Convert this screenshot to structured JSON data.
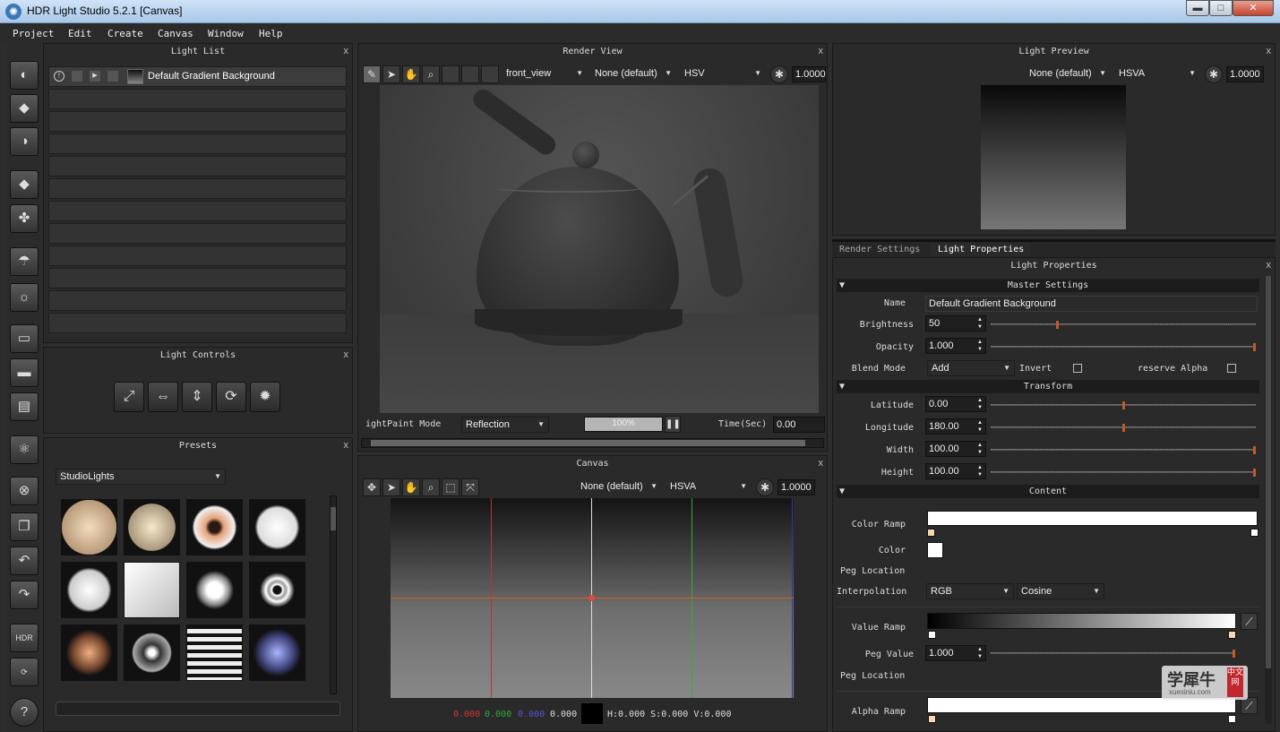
{
  "window": {
    "title": "HDR Light Studio 5.2.1 [Canvas]",
    "min": "▬",
    "max": "□",
    "close": "✕"
  },
  "menu": [
    "Project",
    "Edit",
    "Create",
    "Canvas",
    "Window",
    "Help"
  ],
  "light_list": {
    "title": "Light List",
    "close": "x",
    "item": "Default Gradient Background"
  },
  "light_controls": {
    "title": "Light Controls",
    "close": "x"
  },
  "presets": {
    "title": "Presets",
    "close": "x",
    "category": "StudioLights"
  },
  "render_view": {
    "title": "Render View",
    "close": "x",
    "camera": "front_view",
    "lut": "None (default)",
    "mode": "HSV",
    "exposure": "1.0000",
    "paint_mode_label": "ightPaint Mode",
    "paint_mode": "Reflection",
    "progress": "100%",
    "progress_value": 1.0,
    "time_label": "Time(Sec)",
    "time": "0.00"
  },
  "canvas": {
    "title": "Canvas",
    "close": "x",
    "lut": "None (default)",
    "mode": "HSVA",
    "exposure": "1.0000",
    "r": "0.000",
    "g": "0.000",
    "b": "0.000",
    "a": "0.000",
    "hsv": "H:0.000 S:0.000 V:0.000"
  },
  "light_preview": {
    "title": "Light Preview",
    "close": "x",
    "lut": "None (default)",
    "mode": "HSVA",
    "exposure": "1.0000"
  },
  "tabs": [
    "Render Settings",
    "Light Properties"
  ],
  "props": {
    "title": "Light Properties",
    "close": "x",
    "master": "Master Settings",
    "name_label": "Name",
    "name": "Default Gradient Background",
    "brightness_label": "Brightness",
    "brightness": "50",
    "brightness_pos": 0.25,
    "opacity_label": "Opacity",
    "opacity": "1.000",
    "opacity_pos": 1.0,
    "blend_label": "Blend Mode",
    "blend": "Add",
    "invert_label": "Invert",
    "preserve_label": "reserve Alpha",
    "transform": "Transform",
    "lat_label": "Latitude",
    "lat": "0.00",
    "lat_pos": 0.5,
    "lon_label": "Longitude",
    "lon": "180.00",
    "lon_pos": 0.5,
    "width_label": "Width",
    "width": "100.00",
    "width_pos": 1.0,
    "height_label": "Height",
    "height": "100.00",
    "height_pos": 1.0,
    "content": "Content",
    "color_ramp_label": "Color Ramp",
    "color_label": "Color",
    "peg_loc_label": "Peg Location",
    "interp_label": "Interpolation",
    "interp_space": "RGB",
    "interp_type": "Cosine",
    "value_ramp_label": "Value Ramp",
    "peg_value_label": "Peg Value",
    "peg_value": "1.000",
    "peg_loc2_label": "Peg Location",
    "alpha_ramp_label": "Alpha Ramp"
  },
  "watermark": {
    "main": "学犀牛",
    "site": "xuexiniu.com",
    "side": "中文网"
  },
  "help": "?"
}
